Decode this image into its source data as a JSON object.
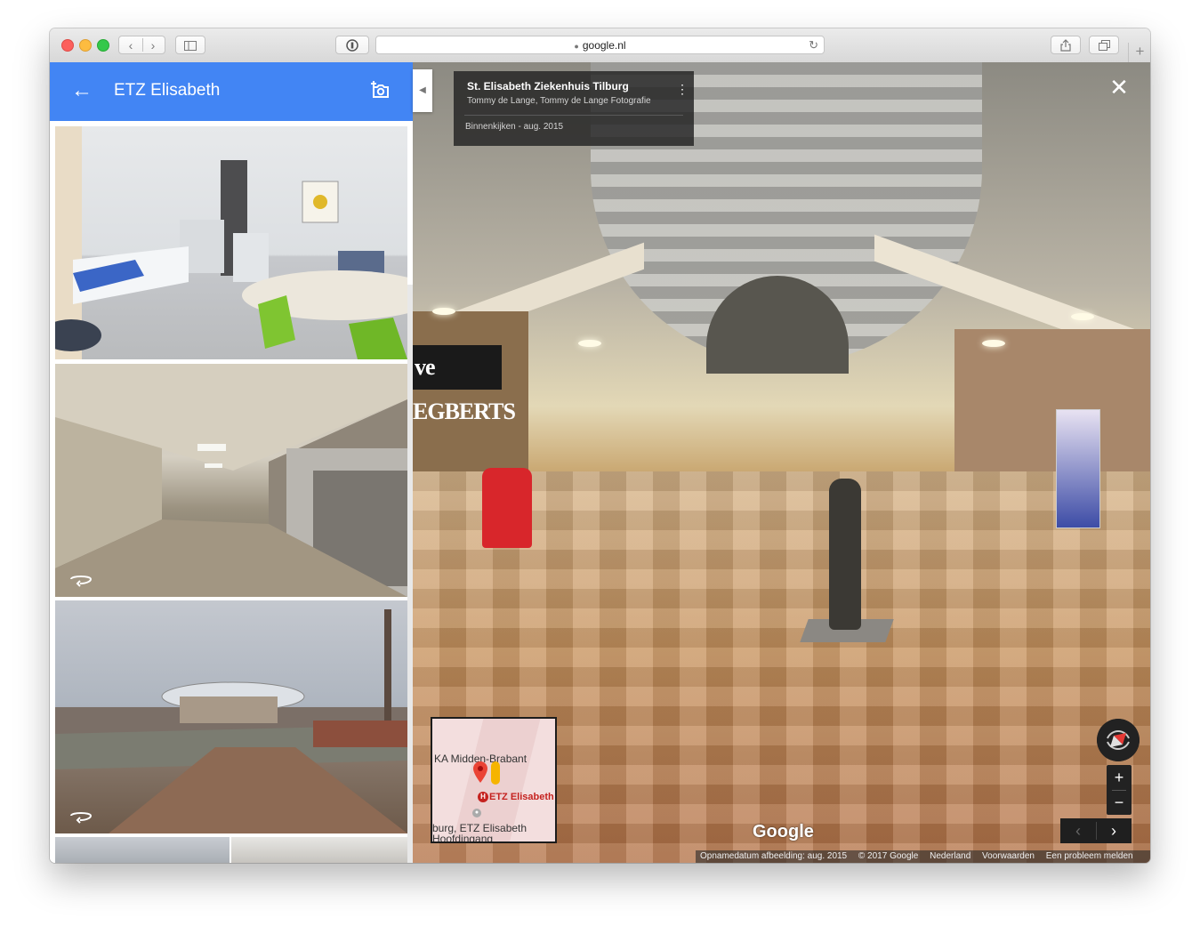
{
  "browser": {
    "url": "google.nl",
    "back_icon": "chevron-left-icon",
    "forward_icon": "chevron-right-icon"
  },
  "panel": {
    "title": "ETZ Elisabeth",
    "back_icon": "arrow-left-icon",
    "add_photo_icon": "add-photo-icon"
  },
  "photos": [
    {
      "type": "photo"
    },
    {
      "type": "panorama",
      "icon": "panorama-360-icon"
    },
    {
      "type": "panorama",
      "icon": "panorama-360-icon"
    },
    {
      "type": "photo"
    },
    {
      "type": "photo"
    }
  ],
  "infocard": {
    "title": "St. Elisabeth Ziekenhuis Tilburg",
    "author": "Tommy de Lange, Tommy de Lange Fotografie",
    "date": "Binnenkijken - aug. 2015"
  },
  "minimap": {
    "label_1": "KA Midden-Brabant",
    "label_2": "ETZ Elisabeth",
    "label_3_line1": "burg, ETZ Elisabeth",
    "label_3_line2": "Hoofdingang",
    "hospital_marker": "H"
  },
  "streetview": {
    "brand": "Google",
    "close_symbol": "✕",
    "zoom_in": "+",
    "zoom_out": "−",
    "sign_text": "ve EGBERTS"
  },
  "footer": {
    "date_label": "Opnamedatum afbeelding: aug. 2015",
    "copyright": "© 2017 Google",
    "country": "Nederland",
    "terms": "Voorwaarden",
    "report": "Een probleem melden"
  },
  "colors": {
    "header_blue": "#4285f4",
    "pin_red": "#c5221f",
    "pegman_yellow": "#f6b400"
  }
}
